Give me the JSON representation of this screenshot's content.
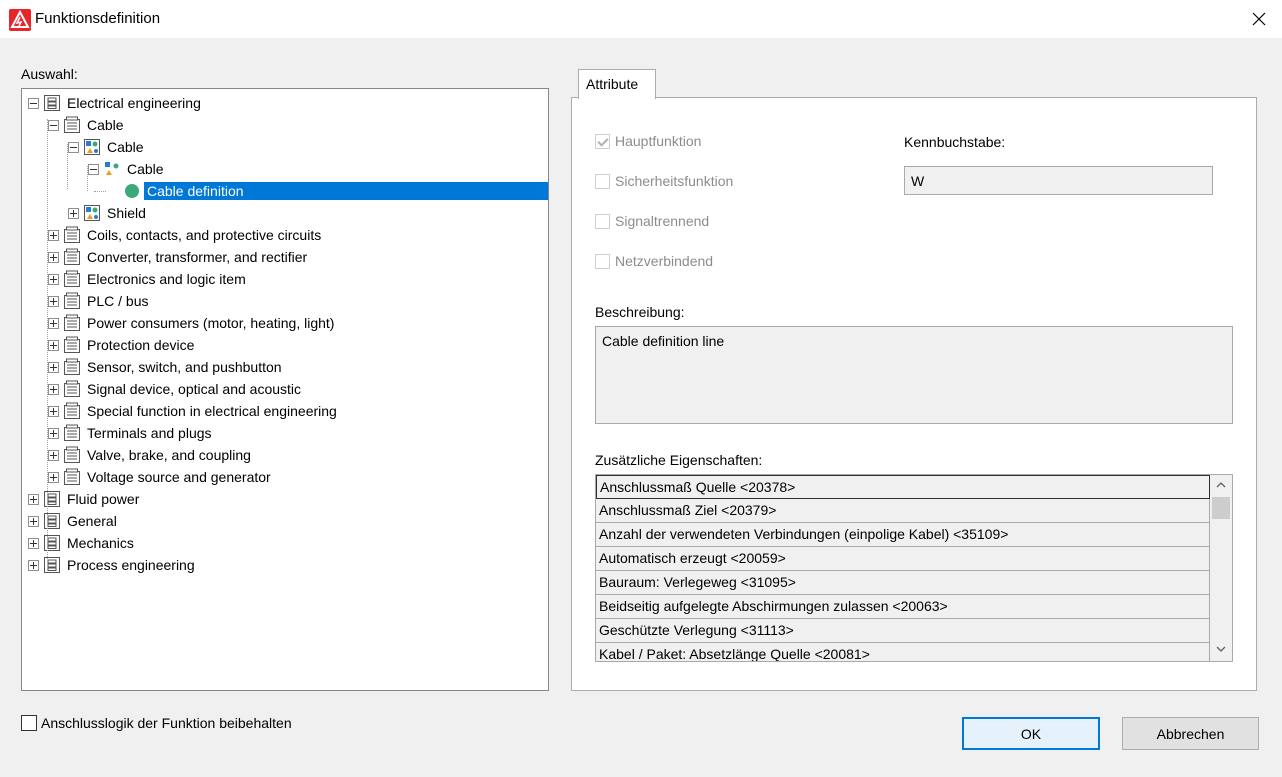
{
  "window": {
    "title": "Funktionsdefinition"
  },
  "left": {
    "label": "Auswahl:",
    "tree": [
      {
        "label": "Electrical engineering",
        "level": 0,
        "expander": "minus",
        "icon": "folder-db-icon"
      },
      {
        "label": "Cable",
        "level": 1,
        "expander": "minus",
        "icon": "category-box-icon"
      },
      {
        "label": "Cable",
        "level": 2,
        "expander": "minus",
        "icon": "group-shapes-icon"
      },
      {
        "label": "Cable",
        "level": 3,
        "expander": "minus",
        "icon": "shapes-small-icon"
      },
      {
        "label": "Cable definition",
        "level": 4,
        "expander": "none",
        "icon": "green-dot-icon",
        "selected": true
      },
      {
        "label": "Shield",
        "level": 2,
        "expander": "plus",
        "icon": "group-shapes-icon"
      },
      {
        "label": "Coils, contacts, and protective circuits",
        "level": 1,
        "expander": "plus",
        "icon": "category-box-icon"
      },
      {
        "label": "Converter, transformer, and rectifier",
        "level": 1,
        "expander": "plus",
        "icon": "category-box-icon"
      },
      {
        "label": "Electronics and logic item",
        "level": 1,
        "expander": "plus",
        "icon": "category-box-icon"
      },
      {
        "label": "PLC / bus",
        "level": 1,
        "expander": "plus",
        "icon": "category-box-icon"
      },
      {
        "label": "Power consumers (motor, heating, light)",
        "level": 1,
        "expander": "plus",
        "icon": "category-box-icon"
      },
      {
        "label": "Protection device",
        "level": 1,
        "expander": "plus",
        "icon": "category-box-icon"
      },
      {
        "label": "Sensor, switch, and pushbutton",
        "level": 1,
        "expander": "plus",
        "icon": "category-box-icon"
      },
      {
        "label": "Signal device, optical and acoustic",
        "level": 1,
        "expander": "plus",
        "icon": "category-box-icon"
      },
      {
        "label": "Special function in electrical engineering",
        "level": 1,
        "expander": "plus",
        "icon": "category-box-icon"
      },
      {
        "label": "Terminals and plugs",
        "level": 1,
        "expander": "plus",
        "icon": "category-box-icon"
      },
      {
        "label": "Valve, brake, and coupling",
        "level": 1,
        "expander": "plus",
        "icon": "category-box-icon"
      },
      {
        "label": "Voltage source and generator",
        "level": 1,
        "expander": "plus",
        "icon": "category-box-icon"
      },
      {
        "label": "Fluid power",
        "level": 0,
        "expander": "plus",
        "icon": "folder-db-icon"
      },
      {
        "label": "General",
        "level": 0,
        "expander": "plus",
        "icon": "folder-db-icon"
      },
      {
        "label": "Mechanics",
        "level": 0,
        "expander": "plus",
        "icon": "folder-db-icon"
      },
      {
        "label": "Process engineering",
        "level": 0,
        "expander": "plus",
        "icon": "folder-db-icon"
      }
    ],
    "keep_logic_label": "Anschlusslogik der Funktion beibehalten",
    "keep_logic_checked": false
  },
  "tabs": [
    {
      "label": "Attribute",
      "active": true
    }
  ],
  "attributes": {
    "checkboxes": [
      {
        "label": "Hauptfunktion",
        "checked": true,
        "disabled": true
      },
      {
        "label": "Sicherheitsfunktion",
        "checked": false,
        "disabled": true
      },
      {
        "label": "Signaltrennend",
        "checked": false,
        "disabled": true
      },
      {
        "label": "Netzverbindend",
        "checked": false,
        "disabled": true
      }
    ],
    "kennbuchstabe_label": "Kennbuchstabe:",
    "kennbuchstabe_value": "W",
    "beschreibung_label": "Beschreibung:",
    "beschreibung_value": "Cable definition line",
    "zusaetzliche_label": "Zusätzliche Eigenschaften:",
    "properties": [
      "Anschlussmaß Quelle <20378>",
      "Anschlussmaß Ziel <20379>",
      "Anzahl der verwendeten Verbindungen (einpolige Kabel) <35109>",
      "Automatisch erzeugt <20059>",
      "Bauraum: Verlegeweg <31095>",
      "Beidseitig aufgelegte Abschirmungen zulassen <20063>",
      "Geschützte Verlegung <31113>",
      "Kabel / Paket: Absetzlänge Quelle <20081>"
    ]
  },
  "buttons": {
    "ok": "OK",
    "cancel": "Abbrechen"
  },
  "colors": {
    "selection": "#0078d7",
    "accent_icon": "#e8252a",
    "node_green": "#3aaa7a"
  }
}
